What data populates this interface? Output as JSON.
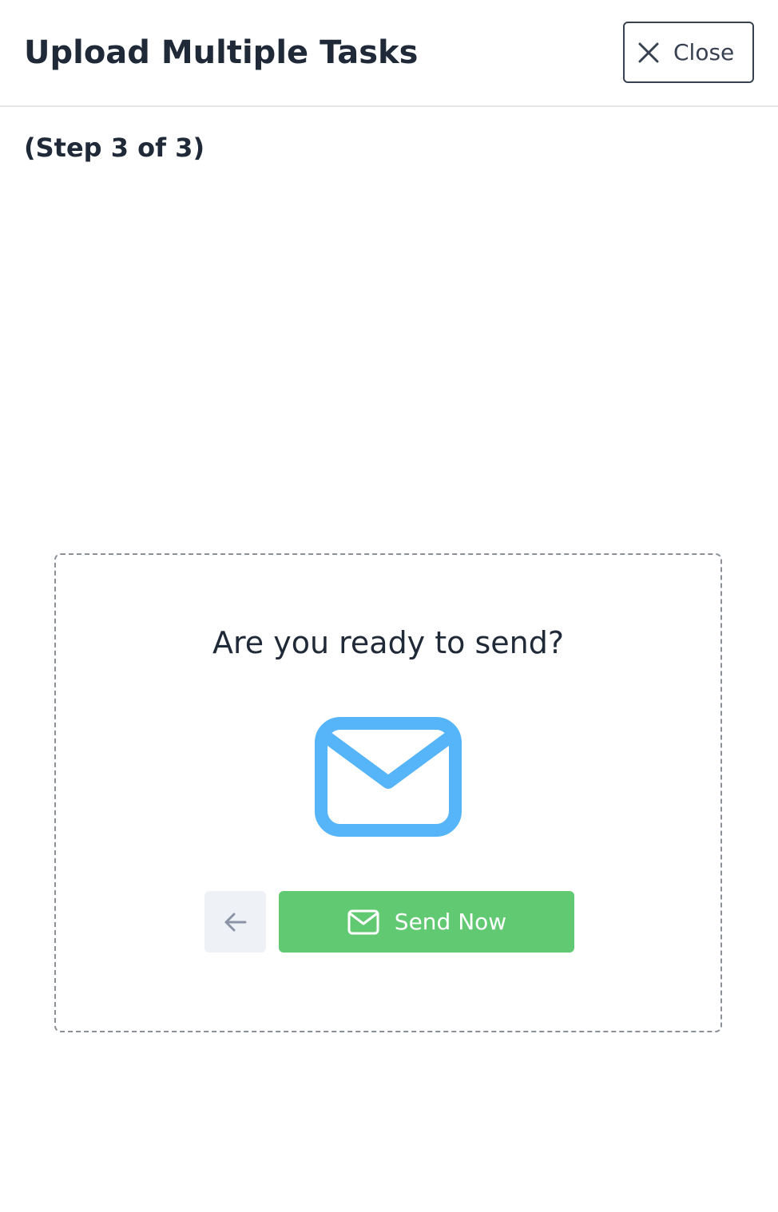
{
  "header": {
    "title": "Upload Multiple Tasks",
    "close_label": "Close",
    "close_icon": "close-x-icon"
  },
  "step": {
    "text": "(Step 3 of 3)"
  },
  "card": {
    "question": "Are you ready to send?",
    "illustration_icon": "envelope-icon",
    "back_icon": "arrow-left-icon",
    "send_label": "Send Now",
    "send_icon": "envelope-icon"
  },
  "colors": {
    "text_dark": "#1f2937",
    "envelope_blue": "#56b4f8",
    "send_green": "#62c973",
    "back_bg": "#eef1f6",
    "back_arrow": "#8a94a6",
    "card_border": "#8b8f96"
  }
}
